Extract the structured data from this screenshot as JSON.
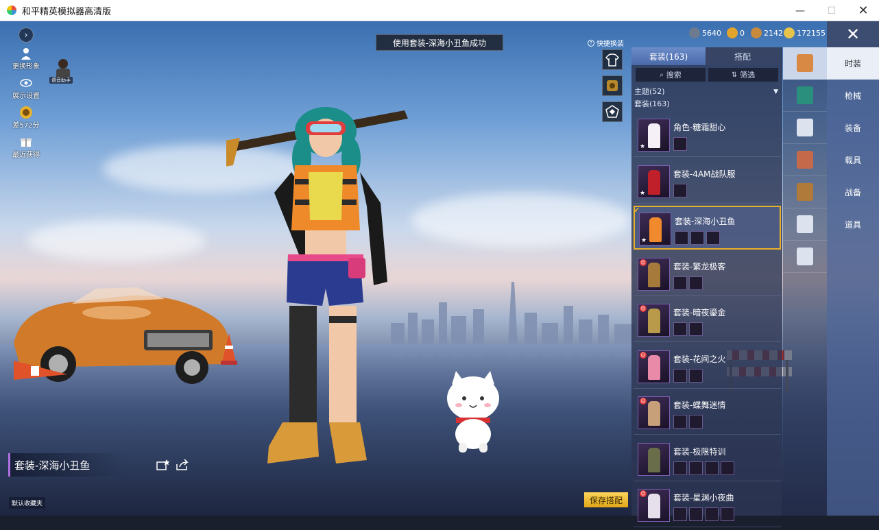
{
  "window": {
    "title": "和平精英模拟器高清版",
    "minimize": "—",
    "maximize": "☐",
    "close": "✕"
  },
  "toast": "使用套装-深海小丑鱼成功",
  "left_menu": {
    "expand": "›",
    "items": [
      {
        "label": "更换形象",
        "icon": "person-icon"
      },
      {
        "label": "展示设置",
        "icon": "eye-icon"
      },
      {
        "label": "差572分",
        "icon": "rank-badge-icon"
      },
      {
        "label": "最近获得",
        "icon": "gift-icon"
      }
    ],
    "voice_helper": "语音助手"
  },
  "currency": [
    {
      "value": "5640",
      "color": "#6d7a8f"
    },
    {
      "value": "0",
      "color": "#e3a42b"
    },
    {
      "value": "2142",
      "color": "#c98a3c"
    },
    {
      "value": "172155",
      "color": "#e8c34a"
    }
  ],
  "quick_swap": {
    "label": "快捷换装",
    "help": "?"
  },
  "inventory": {
    "tabs": [
      "套装(163)",
      "搭配"
    ],
    "search": "搜索",
    "filter": "筛选",
    "theme_filter": "主题(52)",
    "category_filter": "套装(163)",
    "items": [
      {
        "name": "角色-糖霜甜心",
        "badge": "star",
        "minis": 1,
        "color": "#f4f0f5",
        "selected": false
      },
      {
        "name": "套装-4AM战队服",
        "badge": "star",
        "minis": 1,
        "color": "#c0202a",
        "selected": false
      },
      {
        "name": "套装-深海小丑鱼",
        "badge": "star",
        "minis": 3,
        "color": "#f08a2c",
        "selected": true
      },
      {
        "name": "套装-繁龙极客",
        "badge": "smile",
        "minis": 2,
        "color": "#a67a3a",
        "selected": false
      },
      {
        "name": "套装-暗夜鎏金",
        "badge": "smile",
        "minis": 2,
        "color": "#b89a4a",
        "selected": false
      },
      {
        "name": "套装-花间之火",
        "badge": "smile",
        "minis": 2,
        "color": "#e88aa8",
        "selected": false
      },
      {
        "name": "套装-蝶舞迷情",
        "badge": "smile",
        "minis": 2,
        "color": "#c7a07a",
        "selected": false
      },
      {
        "name": "套装-极限特训",
        "badge": "none",
        "minis": 4,
        "color": "#6a6d4a",
        "selected": false
      },
      {
        "name": "套装-星渊小夜曲",
        "badge": "smile",
        "minis": 4,
        "color": "#e6e0ec",
        "selected": false
      }
    ]
  },
  "categories": [
    {
      "icon": "outfit-icon",
      "color": "#d88a44",
      "active": true
    },
    {
      "icon": "hat-icon",
      "color": "#2b8f7d",
      "active": false
    },
    {
      "icon": "goggles-icon",
      "color": "#dde3ee",
      "active": false
    },
    {
      "icon": "top-icon",
      "color": "#c46a4a",
      "active": false
    },
    {
      "icon": "suit-icon",
      "color": "#b07a3a",
      "active": false
    },
    {
      "icon": "pants-icon",
      "color": "#dde3ee",
      "active": false
    },
    {
      "icon": "shoes-icon",
      "color": "#dde3ee",
      "active": false
    }
  ],
  "right_nav": {
    "close": "✕",
    "items": [
      "时装",
      "枪械",
      "装备",
      "载具",
      "战备",
      "道具"
    ]
  },
  "current_outfit": "套装-深海小丑鱼",
  "default_favorites": "默认收藏夹",
  "save_button": "保存搭配"
}
